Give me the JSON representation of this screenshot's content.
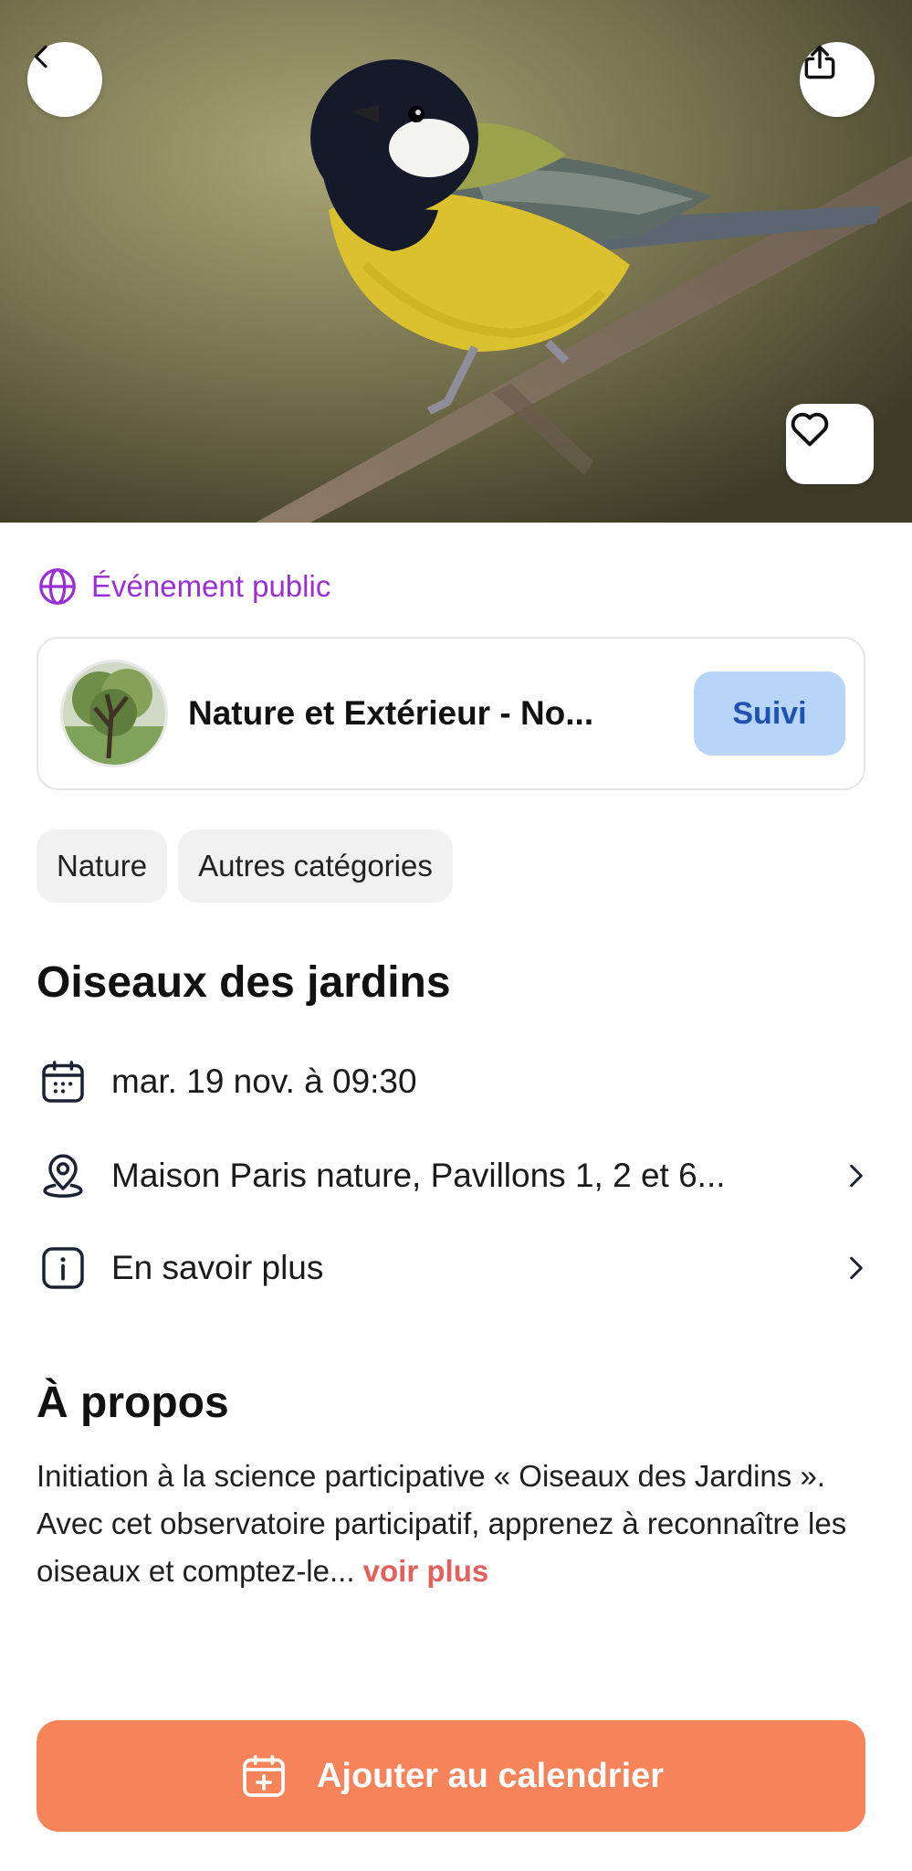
{
  "hero": {
    "image_alt": "Mésange charbonnière sur une branche"
  },
  "event_visibility": {
    "label": "Événement public"
  },
  "organizer": {
    "name": "Nature et Extérieur - No...",
    "follow_label": "Suivi"
  },
  "categories": [
    "Nature",
    "Autres catégories"
  ],
  "event": {
    "title": "Oiseaux des jardins",
    "date": "mar. 19 nov. à 09:30",
    "location": "Maison Paris nature, Pavillons 1, 2 et 6...",
    "more_info": "En savoir plus"
  },
  "about": {
    "title": "À propos",
    "text": "Initiation à la science participative « Oiseaux des Jardins ». Avec cet observatoire participatif, apprenez à reconnaître les oiseaux et comptez-le... ",
    "more_label": "voir plus"
  },
  "cta": {
    "label": "Ajouter au calendrier"
  },
  "colors": {
    "accent_purple": "#9a2fd6",
    "cta_orange": "#f6835a",
    "follow_bg": "#b8d4f8",
    "follow_text": "#1d52b0",
    "link_red": "#e4605d"
  },
  "icons": [
    "back-icon",
    "share-icon",
    "heart-icon",
    "globe-icon",
    "calendar-icon",
    "location-pin-icon",
    "info-icon",
    "chevron-right-icon",
    "calendar-add-icon"
  ]
}
